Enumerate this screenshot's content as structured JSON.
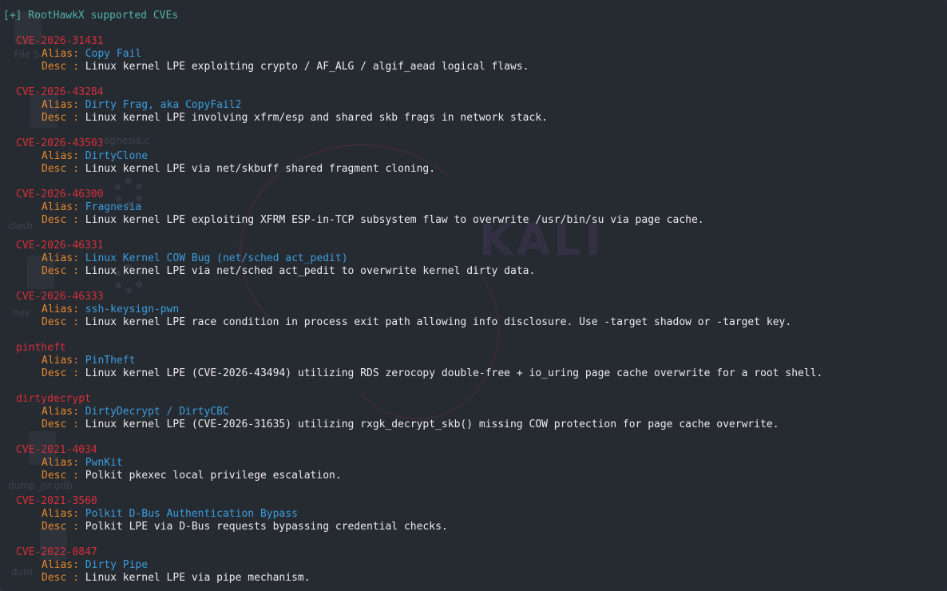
{
  "header": "[+] RootHawkX supported CVEs",
  "alias_key": "Alias: ",
  "desc_key": "Desc : ",
  "background": {
    "brand_word": "KALI",
    "labels": [
      "File S",
      "agnesia.c",
      "clash",
      "hex",
      "dump_jsr.gdb",
      "dum"
    ]
  },
  "entries": [
    {
      "id": "CVE-2026-31431",
      "alias": "Copy Fail",
      "desc": "Linux kernel LPE exploiting crypto / AF_ALG / algif_aead logical flaws."
    },
    {
      "id": "CVE-2026-43284",
      "alias": "Dirty Frag, aka CopyFail2",
      "desc": "Linux kernel LPE involving xfrm/esp and shared skb frags in network stack."
    },
    {
      "id": "CVE-2026-43503",
      "alias": "DirtyClone",
      "desc": "Linux kernel LPE via net/skbuff shared fragment cloning."
    },
    {
      "id": "CVE-2026-46300",
      "alias": "Fragnesia",
      "desc": "Linux kernel LPE exploiting XFRM ESP-in-TCP subsystem flaw to overwrite /usr/bin/su via page cache."
    },
    {
      "id": "CVE-2026-46331",
      "alias": "Linux Kernel COW Bug (net/sched act_pedit)",
      "desc": "Linux kernel LPE via net/sched act_pedit to overwrite kernel dirty data."
    },
    {
      "id": "CVE-2026-46333",
      "alias": "ssh-keysign-pwn",
      "desc": "Linux kernel LPE race condition in process exit path allowing info disclosure. Use -target shadow or -target key."
    },
    {
      "id": "pintheft",
      "alias": "PinTheft",
      "desc": "Linux kernel LPE (CVE-2026-43494) utilizing RDS zerocopy double-free + io_uring page cache overwrite for a root shell."
    },
    {
      "id": "dirtydecrypt",
      "alias": "DirtyDecrypt / DirtyCBC",
      "desc": "Linux kernel LPE (CVE-2026-31635) utilizing rxgk_decrypt_skb() missing COW protection for page cache overwrite."
    },
    {
      "id": "CVE-2021-4034",
      "alias": "PwnKit",
      "desc": "Polkit pkexec local privilege escalation."
    },
    {
      "id": "CVE-2021-3560",
      "alias": "Polkit D-Bus Authentication Bypass",
      "desc": "Polkit LPE via D-Bus requests bypassing credential checks."
    },
    {
      "id": "CVE-2022-0847",
      "alias": "Dirty Pipe",
      "desc": "Linux kernel LPE via pipe mechanism."
    }
  ],
  "colors": {
    "header": "#4fb3a9",
    "id": "#d6303a",
    "key": "#e5892e",
    "alias": "#3b9ede",
    "desc": "#ececec",
    "background": "#262a31"
  }
}
